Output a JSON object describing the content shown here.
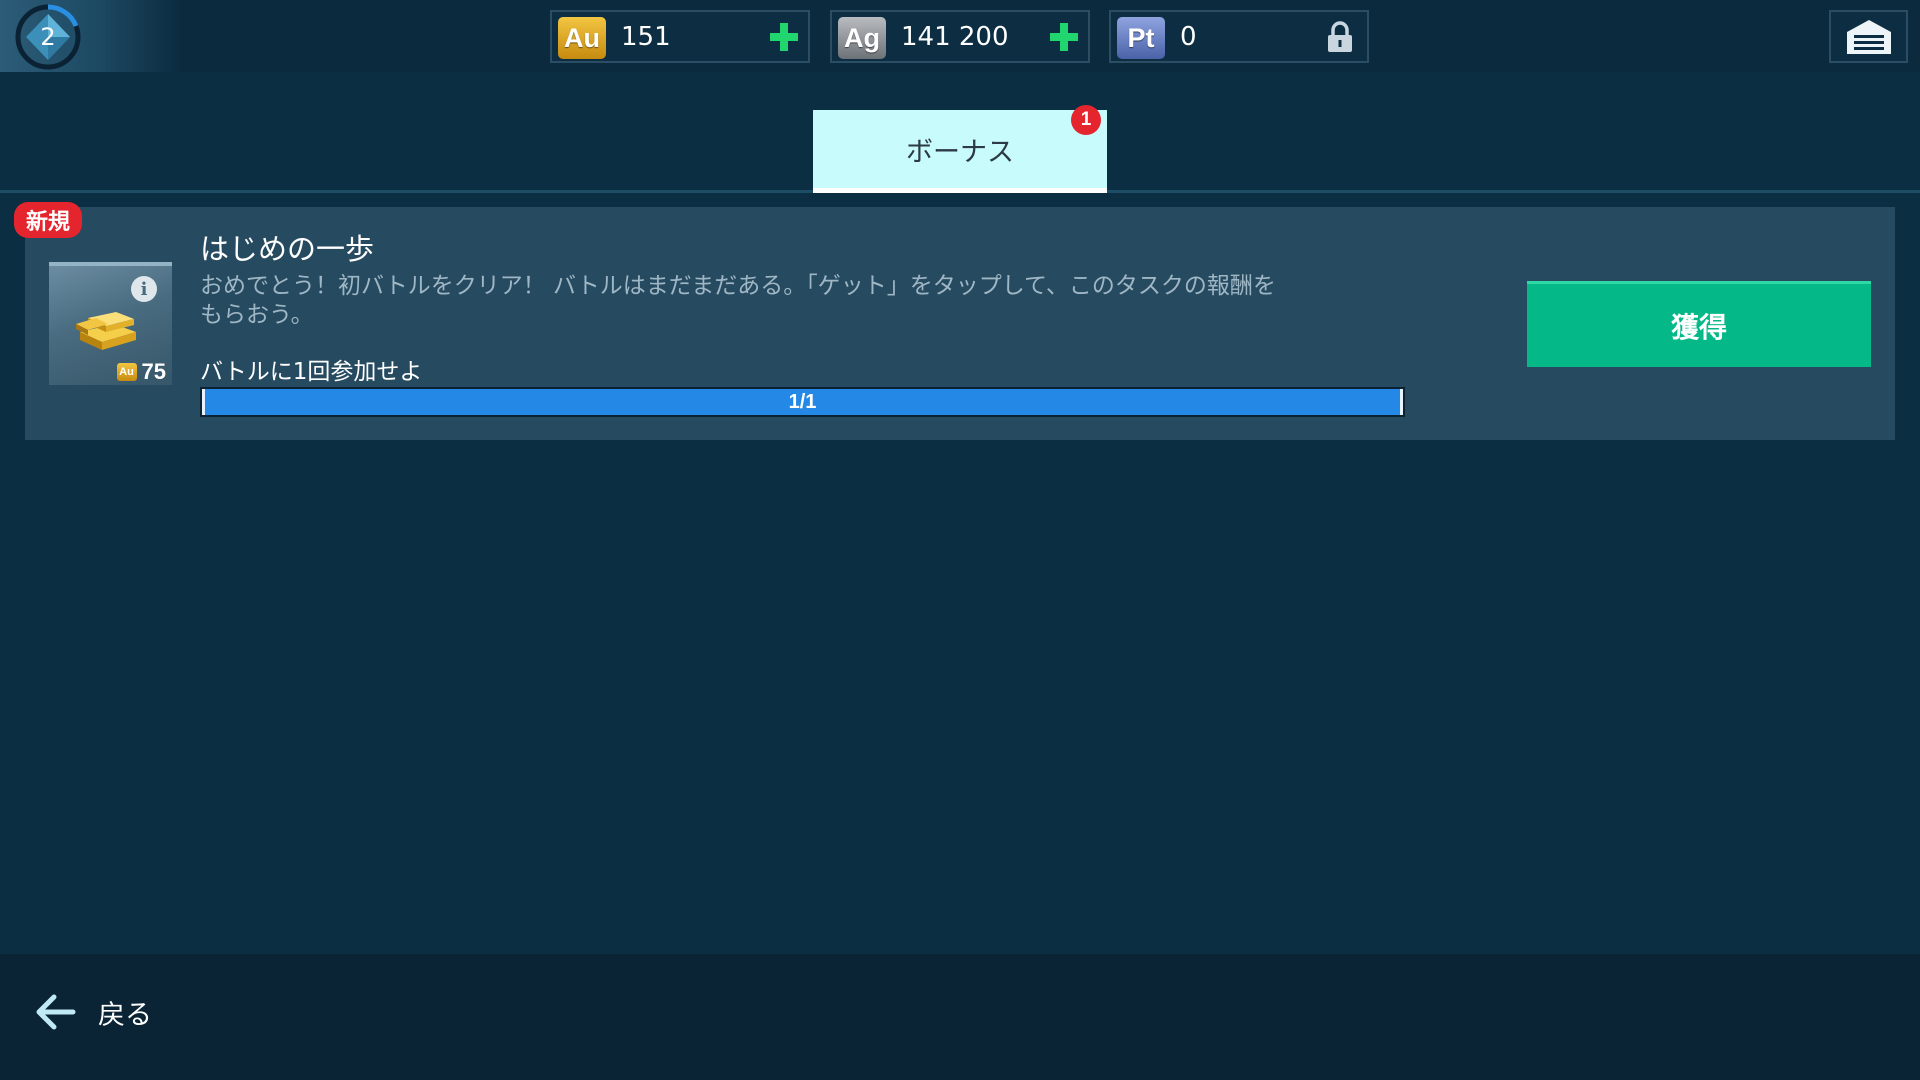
{
  "header": {
    "level": "2",
    "currencies": {
      "gold": {
        "symbol": "Au",
        "value": "151"
      },
      "silver": {
        "symbol": "Ag",
        "value": "141 200"
      },
      "platinum": {
        "symbol": "Pt",
        "value": "0"
      }
    }
  },
  "tabs": {
    "bonus": {
      "label": "ボーナス",
      "badge": "1"
    }
  },
  "task": {
    "badge": "新規",
    "title": "はじめの一歩",
    "description": "おめでとう！初バトルをクリア！ バトルはまだまだある。「ゲット」をタップして、このタスクの報酬をもらおう。",
    "goal": "バトルに1回参加せよ",
    "progress_text": "1/1",
    "progress_fraction": 1.0,
    "reward": {
      "currency_symbol": "Au",
      "amount": "75"
    },
    "claim_label": "獲得"
  },
  "footer": {
    "back_label": "戻る"
  },
  "colors": {
    "background": "#0c2e43",
    "card": "#264a60",
    "tab_active": "#c8fbfc",
    "claim_button": "#04b887",
    "progress": "#2489e6",
    "badge_red": "#e5252d",
    "plus_green": "#21d66e"
  }
}
